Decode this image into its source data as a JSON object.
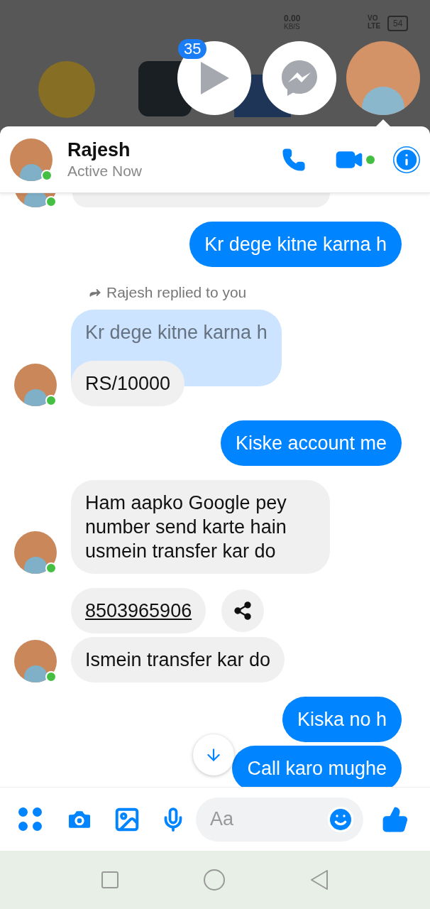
{
  "status_bar": {
    "speed": "0.00",
    "speed_unit": "KB/S",
    "network": "VO LTE",
    "battery": "54"
  },
  "chat_heads": {
    "badge": "35"
  },
  "header": {
    "name": "Rajesh",
    "status": "Active Now",
    "online": true
  },
  "messages": [
    {
      "kind": "out",
      "text": "Kr dege kitne karna h"
    },
    {
      "kind": "reply",
      "note": "Rajesh replied to you",
      "quote": "Kr dege kitne karna h",
      "text": "RS/10000",
      "avatar": true
    },
    {
      "kind": "out",
      "text": "Kiske account me"
    },
    {
      "kind": "in",
      "text": "Ham aapko Google pey number send karte hain usmein transfer kar do",
      "avatar": true
    },
    {
      "kind": "link",
      "text": "8503965906"
    },
    {
      "kind": "in",
      "text": "Ismein transfer kar do",
      "avatar": true
    },
    {
      "kind": "out",
      "text": "Kiska no h"
    },
    {
      "kind": "out",
      "text": "Call karo mughe"
    }
  ],
  "composer": {
    "placeholder": "Aa"
  }
}
